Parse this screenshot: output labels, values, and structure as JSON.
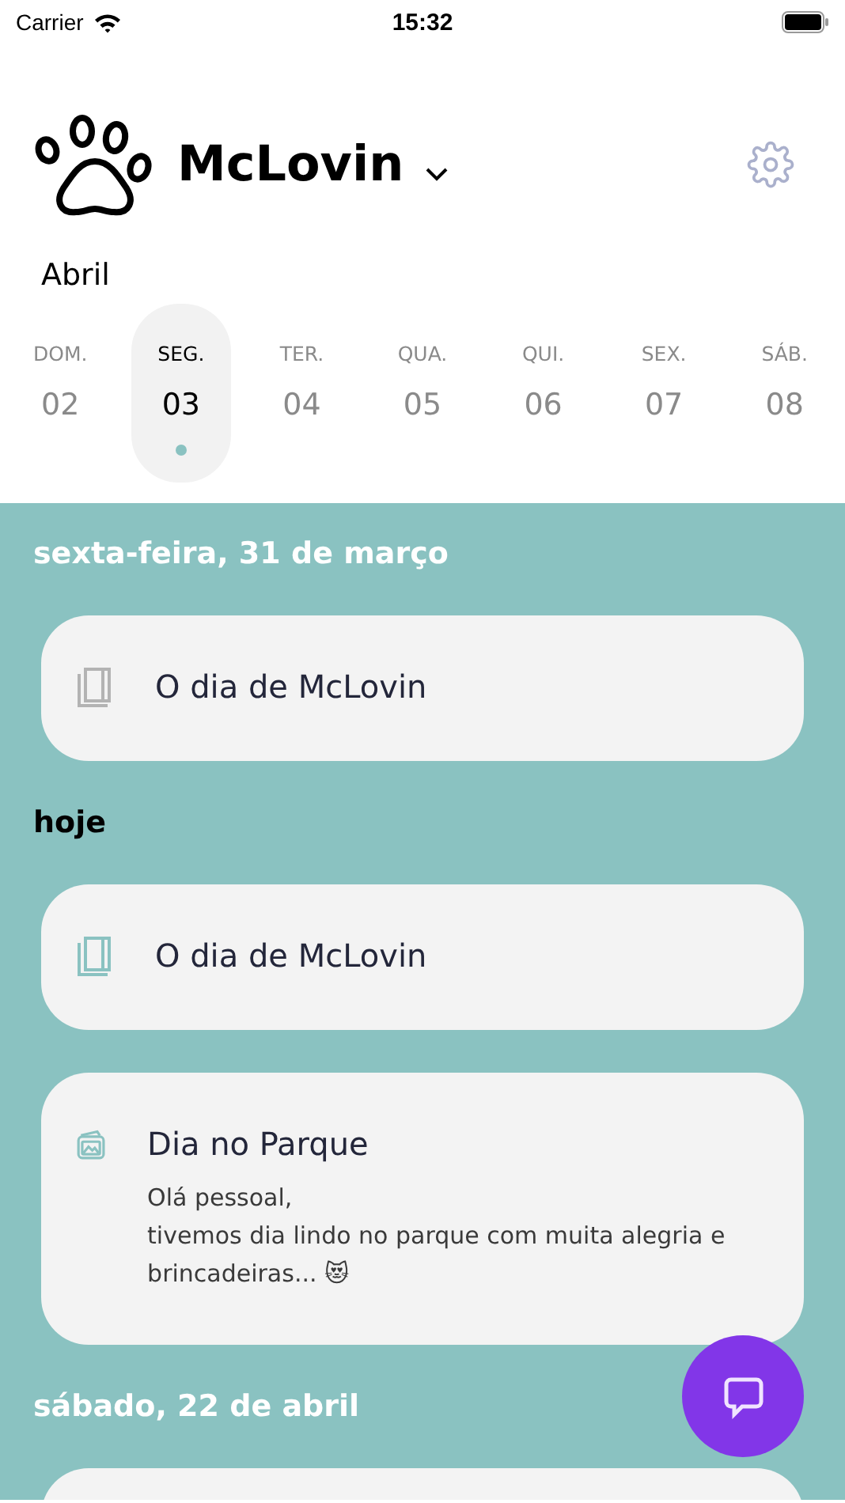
{
  "status_bar": {
    "carrier": "Carrier",
    "time": "15:32"
  },
  "header": {
    "pet_name": "McLovin"
  },
  "month": "Abril",
  "week": [
    {
      "weekday": "DOM.",
      "day": "02",
      "selected": false,
      "has_entry": false
    },
    {
      "weekday": "SEG.",
      "day": "03",
      "selected": true,
      "has_entry": true
    },
    {
      "weekday": "TER.",
      "day": "04",
      "selected": false,
      "has_entry": false
    },
    {
      "weekday": "QUA.",
      "day": "05",
      "selected": false,
      "has_entry": false
    },
    {
      "weekday": "QUI.",
      "day": "06",
      "selected": false,
      "has_entry": false
    },
    {
      "weekday": "SEX.",
      "day": "07",
      "selected": false,
      "has_entry": false
    },
    {
      "weekday": "SÁB.",
      "day": "08",
      "selected": false,
      "has_entry": false
    }
  ],
  "feed": [
    {
      "heading": "sexta-feira, 31 de março",
      "today": false,
      "entries": [
        {
          "kind": "journal",
          "color": "#b3b3b3",
          "title": "O dia de McLovin"
        }
      ]
    },
    {
      "heading": "hoje",
      "today": true,
      "entries": [
        {
          "kind": "journal",
          "color": "#8ac2c1",
          "title": "O dia de McLovin"
        },
        {
          "kind": "photo",
          "color": "#8ac2c1",
          "title": "Dia no Parque",
          "body": [
            "Olá pessoal,",
            "tivemos dia lindo no parque com muita alegria e brincadeiras... 😻"
          ]
        }
      ]
    },
    {
      "heading": "sábado, 22 de abril",
      "today": false,
      "entries": [
        {
          "kind": "partial"
        }
      ]
    }
  ]
}
